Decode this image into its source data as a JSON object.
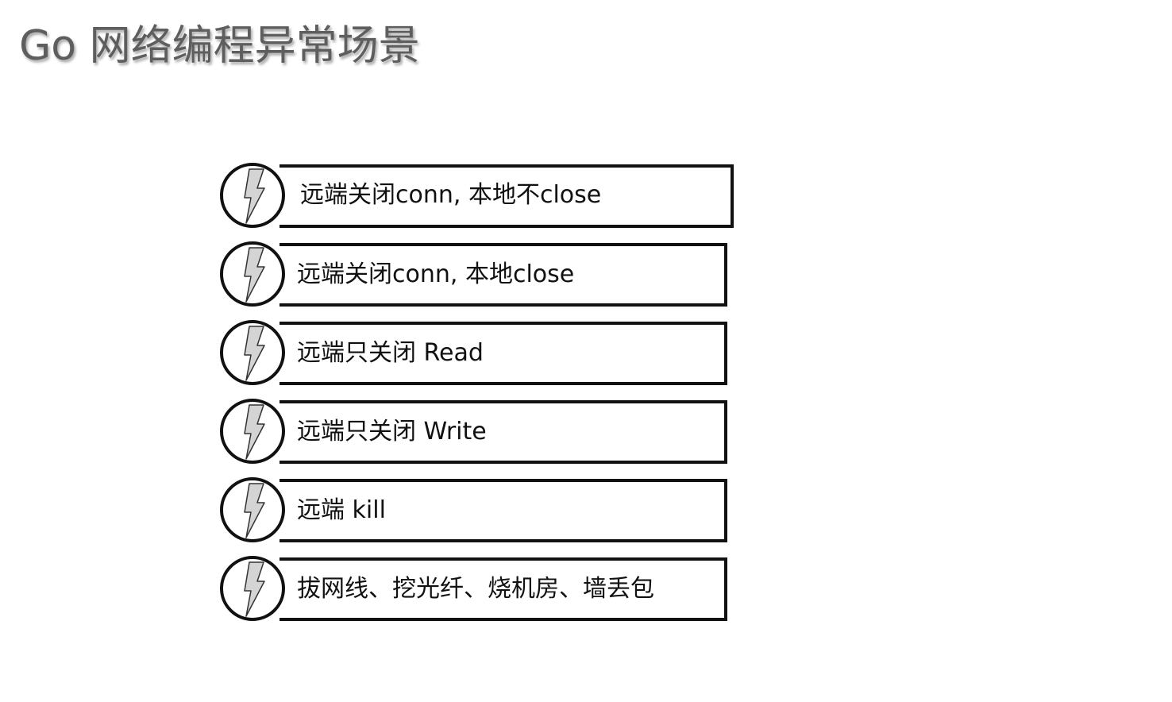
{
  "title": "Go 网络编程异常场景",
  "scenarios": [
    {
      "label": "远端关闭conn, 本地不close",
      "icon": "lightning-icon"
    },
    {
      "label": "远端关闭conn, 本地close",
      "icon": "lightning-icon"
    },
    {
      "label": "远端只关闭 Read",
      "icon": "lightning-icon"
    },
    {
      "label": "远端只关闭 Write",
      "icon": "lightning-icon"
    },
    {
      "label": "远端 kill",
      "icon": "lightning-icon"
    },
    {
      "label": "拔网线、挖光纤、烧机房、墙丢包",
      "icon": "lightning-icon"
    }
  ],
  "colors": {
    "title": "#5e5e5e",
    "outline": "#111111",
    "bolt_fill": "#d4d4d4",
    "bolt_stroke": "#333333"
  }
}
